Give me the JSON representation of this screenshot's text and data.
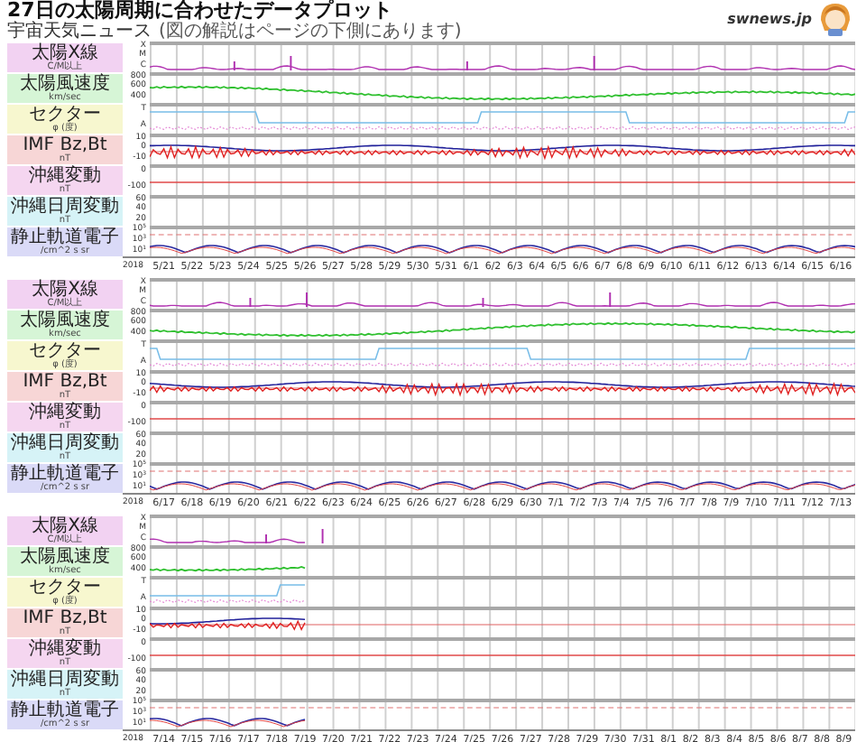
{
  "title": "27日の太陽周期に合わせたデータプロット",
  "subtitle": "宇宙天気ニュース",
  "note": "(図の解説はページの下側にあります)",
  "logo": {
    "text": "swnews.jp"
  },
  "panels": [
    {
      "kind": "complete",
      "year": "2018",
      "dates": [
        "5/21",
        "5/22",
        "5/23",
        "5/24",
        "5/25",
        "5/26",
        "5/27",
        "5/28",
        "5/29",
        "5/30",
        "5/31",
        "6/1",
        "6/2",
        "6/3",
        "6/4",
        "6/5",
        "6/6",
        "6/7",
        "6/8",
        "6/9",
        "6/10",
        "6/11",
        "6/12",
        "6/13",
        "6/14",
        "6/15",
        "6/16"
      ],
      "rows": [
        {
          "kind": "xray",
          "label": "太陽X線",
          "unit": "C/M以上",
          "color": "#f2d2f2",
          "ticks": [
            "X",
            "M",
            "C"
          ]
        },
        {
          "kind": "speed",
          "label": "太陽風速度",
          "unit": "km/sec",
          "color": "#d6f5d6",
          "ticks": [
            "800",
            "600",
            "400"
          ]
        },
        {
          "kind": "sector",
          "label": "セクター",
          "unit": "φ (度)",
          "color": "#f7f7cf",
          "ticks": [
            "T",
            "A"
          ]
        },
        {
          "kind": "imf",
          "label": "IMF Bz,Bt",
          "unit": "nT",
          "color": "#f7d6d6",
          "ticks": [
            "10",
            "0",
            "-10"
          ]
        },
        {
          "kind": "geomag",
          "label": "沖縄変動",
          "unit": "nT",
          "color": "#f5d6f0",
          "ticks": [
            "0",
            "-100"
          ]
        },
        {
          "kind": "daily",
          "label": "沖縄日周変動",
          "unit": "nT",
          "color": "#d6f3f7",
          "ticks": [
            "60",
            "40",
            "20"
          ]
        },
        {
          "kind": "electron",
          "label": "静止軌道電子",
          "unit": "/cm^2 s sr",
          "color": "#dadaf7",
          "ticks": [
            "10$^{5}$",
            "10$^{3}$",
            "10$^{1}$"
          ]
        }
      ]
    },
    {
      "kind": "complete",
      "year": "2018",
      "dates": [
        "6/17",
        "6/18",
        "6/19",
        "6/20",
        "6/21",
        "6/22",
        "6/23",
        "6/24",
        "6/25",
        "6/26",
        "6/27",
        "6/28",
        "6/29",
        "6/30",
        "7/1",
        "7/2",
        "7/3",
        "7/4",
        "7/5",
        "7/6",
        "7/7",
        "7/8",
        "7/9",
        "7/10",
        "7/11",
        "7/12",
        "7/13"
      ],
      "rows": [
        {
          "kind": "xray",
          "label": "太陽X線",
          "unit": "C/M以上",
          "color": "#f2d2f2",
          "ticks": [
            "X",
            "M",
            "C"
          ]
        },
        {
          "kind": "speed",
          "label": "太陽風速度",
          "unit": "km/sec",
          "color": "#d6f5d6",
          "ticks": [
            "800",
            "600",
            "400"
          ]
        },
        {
          "kind": "sector",
          "label": "セクター",
          "unit": "φ (度)",
          "color": "#f7f7cf",
          "ticks": [
            "T",
            "A"
          ]
        },
        {
          "kind": "imf",
          "label": "IMF Bz,Bt",
          "unit": "nT",
          "color": "#f7d6d6",
          "ticks": [
            "10",
            "0",
            "-10"
          ]
        },
        {
          "kind": "geomag",
          "label": "沖縄変動",
          "unit": "nT",
          "color": "#f5d6f0",
          "ticks": [
            "0",
            "-100"
          ]
        },
        {
          "kind": "daily",
          "label": "沖縄日周変動",
          "unit": "nT",
          "color": "#d6f3f7",
          "ticks": [
            "60",
            "40",
            "20"
          ]
        },
        {
          "kind": "electron",
          "label": "静止軌道電子",
          "unit": "/cm^2 s sr",
          "color": "#dadaf7",
          "ticks": [
            "10$^{5}$",
            "10$^{3}$",
            "10$^{1}$"
          ]
        }
      ]
    },
    {
      "kind": "partial",
      "year": "2018",
      "dates": [
        "7/14",
        "7/15",
        "7/16",
        "7/17",
        "7/18",
        "7/19",
        "7/20",
        "7/21",
        "7/22",
        "7/23",
        "7/24",
        "7/25",
        "7/26",
        "7/27",
        "7/28",
        "7/29",
        "7/30",
        "7/31",
        "8/1",
        "8/2",
        "8/3",
        "8/4",
        "8/5",
        "8/6",
        "8/7",
        "8/8",
        "8/9"
      ],
      "rows": [
        {
          "kind": "xray",
          "label": "太陽X線",
          "unit": "C/M以上",
          "color": "#f2d2f2",
          "ticks": [
            "X",
            "M",
            "C"
          ]
        },
        {
          "kind": "speed",
          "label": "太陽風速度",
          "unit": "km/sec",
          "color": "#d6f5d6",
          "ticks": [
            "800",
            "600",
            "400"
          ]
        },
        {
          "kind": "sector",
          "label": "セクター",
          "unit": "φ (度)",
          "color": "#f7f7cf",
          "ticks": [
            "T",
            "A"
          ]
        },
        {
          "kind": "imf",
          "label": "IMF Bz,Bt",
          "unit": "nT",
          "color": "#f7d6d6",
          "ticks": [
            "10",
            "0",
            "-10"
          ]
        },
        {
          "kind": "geomag",
          "label": "沖縄変動",
          "unit": "nT",
          "color": "#f5d6f0",
          "ticks": [
            "0",
            "-100"
          ]
        },
        {
          "kind": "daily",
          "label": "沖縄日周変動",
          "unit": "nT",
          "color": "#d6f3f7",
          "ticks": [
            "60",
            "40",
            "20"
          ]
        },
        {
          "kind": "electron",
          "label": "静止軌道電子",
          "unit": "/cm^2 s sr",
          "color": "#dadaf7",
          "ticks": [
            "10$^{5}$",
            "10$^{3}$",
            "10$^{1}$"
          ]
        }
      ]
    }
  ]
}
